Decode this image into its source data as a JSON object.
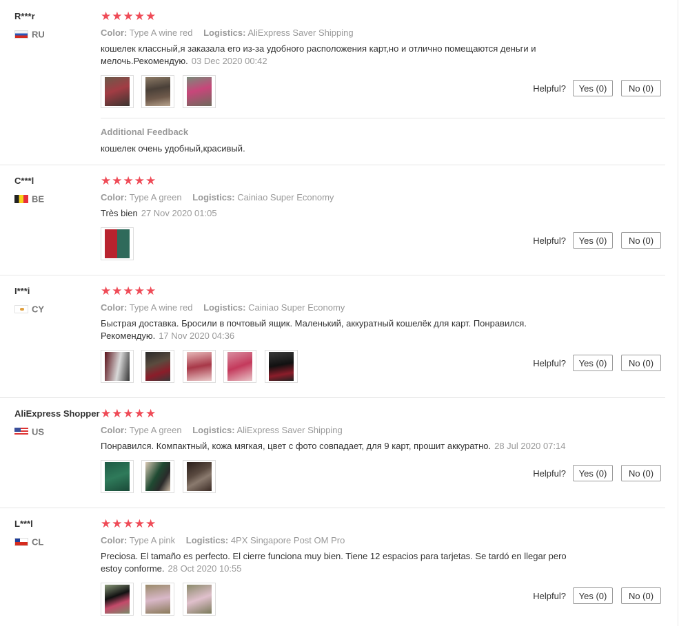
{
  "common": {
    "color_label": "Color:",
    "logistics_label": "Logistics:",
    "helpful_label": "Helpful?",
    "yes_label": "Yes (0)",
    "no_label": "No (0)",
    "star_color": "#ef4b57",
    "rating": 5
  },
  "reviews": [
    {
      "user": "R***r",
      "country": "RU",
      "flag": "flag-russia-icon",
      "stars": "★★★★★",
      "color": "Type A wine red",
      "logistics": "AliExpress Saver Shipping",
      "text": "кошелек классный,я заказала его из-за удобного расположения карт,но и отлично помещаются деньги и мелочь.Рекомендую.",
      "date": "03 Dec 2020 00:42",
      "photos": [
        "review-photo",
        "review-photo",
        "review-photo"
      ],
      "additional_feedback": {
        "title": "Additional Feedback",
        "text": "кошелек очень удобный,красивый."
      }
    },
    {
      "user": "C***l",
      "country": "BE",
      "flag": "flag-belgium-icon",
      "stars": "★★★★★",
      "color": "Type A green",
      "logistics": "Cainiao Super Economy",
      "text": "Très bien",
      "date": "27 Nov 2020 01:05",
      "photos": [
        "review-photo"
      ]
    },
    {
      "user": "I***i",
      "country": "CY",
      "flag": "flag-cyprus-icon",
      "stars": "★★★★★",
      "color": "Type A wine red",
      "logistics": "Cainiao Super Economy",
      "text": "Быстрая доставка. Бросили в почтовый ящик. Маленький, аккуратный кошелёк для карт. Понравился. Рекомендую.",
      "date": "17 Nov 2020 04:36",
      "photos": [
        "review-photo",
        "review-photo",
        "review-photo",
        "review-photo",
        "review-photo"
      ]
    },
    {
      "user": "AliExpress Shopper",
      "country": "US",
      "flag": "flag-usa-icon",
      "stars": "★★★★★",
      "color": "Type A green",
      "logistics": "AliExpress Saver Shipping",
      "text": "Понравился. Компактный, кожа мягкая, цвет с фото совпадает, для 9 карт, прошит аккуратно.",
      "date": "28 Jul 2020 07:14",
      "photos": [
        "review-photo",
        "review-photo",
        "review-photo"
      ]
    },
    {
      "user": "L***l",
      "country": "CL",
      "flag": "flag-chile-icon",
      "stars": "★★★★★",
      "color": "Type A pink",
      "logistics": "4PX Singapore Post OM Pro",
      "text": "Preciosa. El tamaño es perfecto. El cierre funciona muy bien. Tiene 12 espacios para tarjetas. Se tardó en llegar pero estoy conforme.",
      "date": "28 Oct 2020 10:55",
      "photos": [
        "review-photo",
        "review-photo",
        "review-photo"
      ]
    }
  ]
}
